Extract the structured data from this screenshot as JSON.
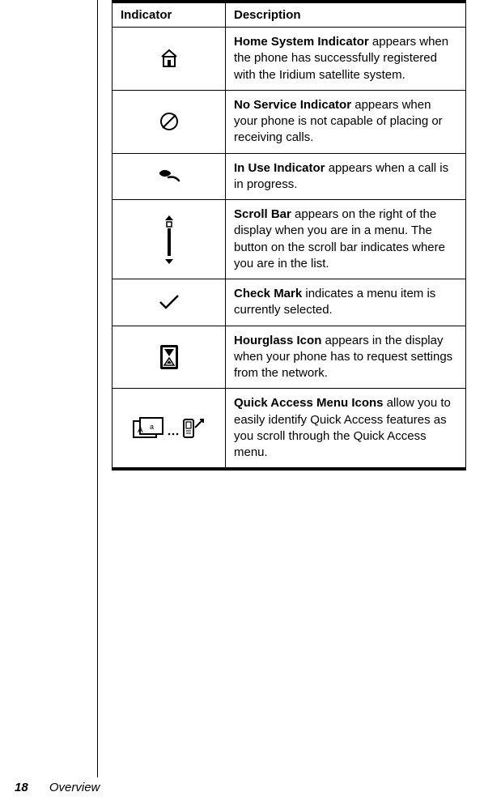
{
  "table": {
    "headers": {
      "indicator": "Indicator",
      "description": "Description"
    },
    "rows": [
      {
        "bold": "Home System Indicator",
        "rest": " appears when the phone has successfully registered with the Iridium satellite system."
      },
      {
        "bold": "No Service Indicator",
        "rest": " appears when your phone is not capable of placing or receiving calls."
      },
      {
        "bold": "In Use Indicator",
        "rest": " appears when a call is in progress."
      },
      {
        "bold": "Scroll Bar",
        "rest": " appears on the right of the display when you are in a menu. The button on the scroll bar indicates where you are in the list."
      },
      {
        "bold": "Check Mark",
        "rest": " indicates a menu item is currently selected."
      },
      {
        "bold": "Hourglass Icon",
        "rest": " appears in the display when your phone has to request settings from the network."
      },
      {
        "bold": "Quick Access Menu Icons",
        "rest": " allow you to easily identify Quick Access features as you scroll through the Quick Access menu."
      }
    ]
  },
  "footer": {
    "page_number": "18",
    "section": "Overview"
  }
}
